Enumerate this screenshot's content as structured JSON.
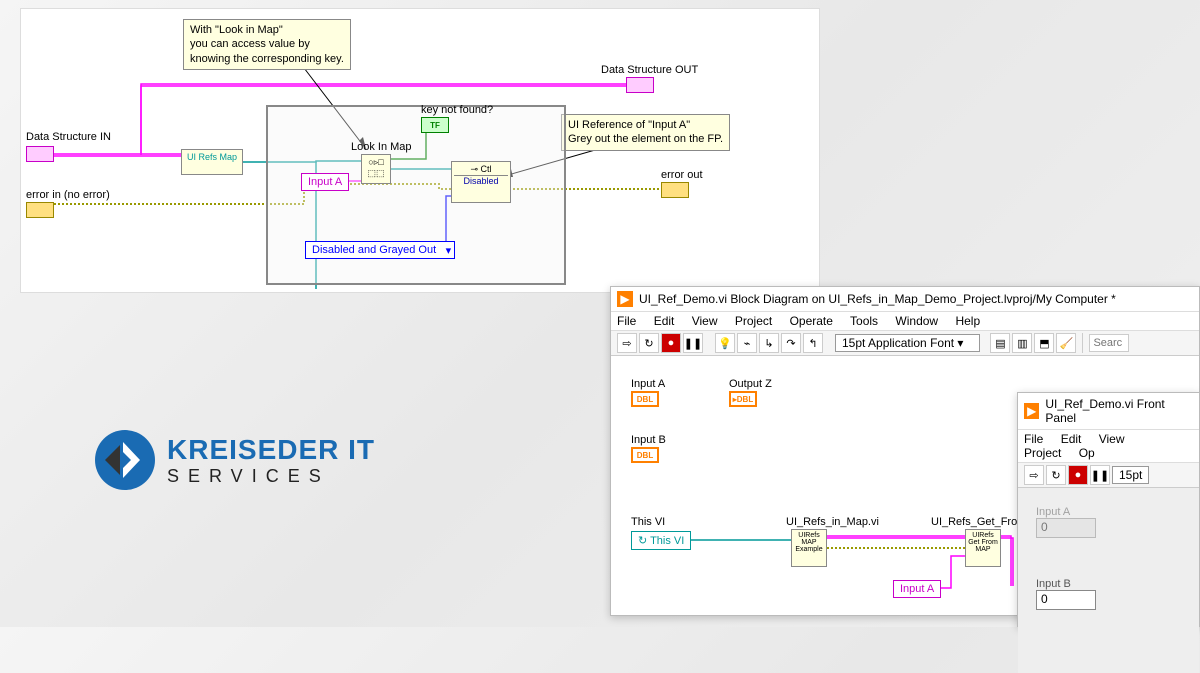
{
  "top_diagram": {
    "note_look_in_map": "With \"Look in Map\"\nyou can access value by\nknowing the corresponding key.",
    "note_ui_ref": "UI Reference of \"Input A\"\nGrey out the element on the FP.",
    "data_structure_in": "Data Structure IN",
    "data_structure_out": "Data Structure OUT",
    "error_in": "error in (no error)",
    "error_out": "error out",
    "ui_refs_map": "UI Refs Map",
    "look_in_map": "Look In Map",
    "key_not_found": "key not found?",
    "ctl": "Ctl",
    "disabled": "Disabled",
    "input_a": "Input A",
    "enum_val": "Disabled and Grayed Out",
    "tf_label": "TF"
  },
  "logo": {
    "title": "KREISEDER IT",
    "subtitle": "SERVICES"
  },
  "bd_window": {
    "title": "UI_Ref_Demo.vi Block Diagram on UI_Refs_in_Map_Demo_Project.lvproj/My Computer *",
    "menus": [
      "File",
      "Edit",
      "View",
      "Project",
      "Operate",
      "Tools",
      "Window",
      "Help"
    ],
    "font": "15pt Application Font",
    "search_placeholder": "Searc",
    "labels": {
      "input_a": "Input A",
      "input_b": "Input B",
      "output_z": "Output Z",
      "this_vi": "This VI",
      "this_vi_const": "This VI",
      "vi1": "UI_Refs_in_Map.vi",
      "vi2": "UI_Refs_Get_From_Map.vi",
      "vi1_icon": "UIRefs\nMAP\nExample",
      "vi2_icon": "UIRefs\nGet\nFrom\nMAP",
      "input_a_const": "Input A",
      "dbl": "DBL"
    }
  },
  "fp_window": {
    "title": "UI_Ref_Demo.vi Front Panel",
    "menus": [
      "File",
      "Edit",
      "View",
      "Project",
      "Op"
    ],
    "font": "15pt",
    "input_a": "Input A",
    "input_b": "Input B",
    "val_a": "0",
    "val_b": "0"
  }
}
